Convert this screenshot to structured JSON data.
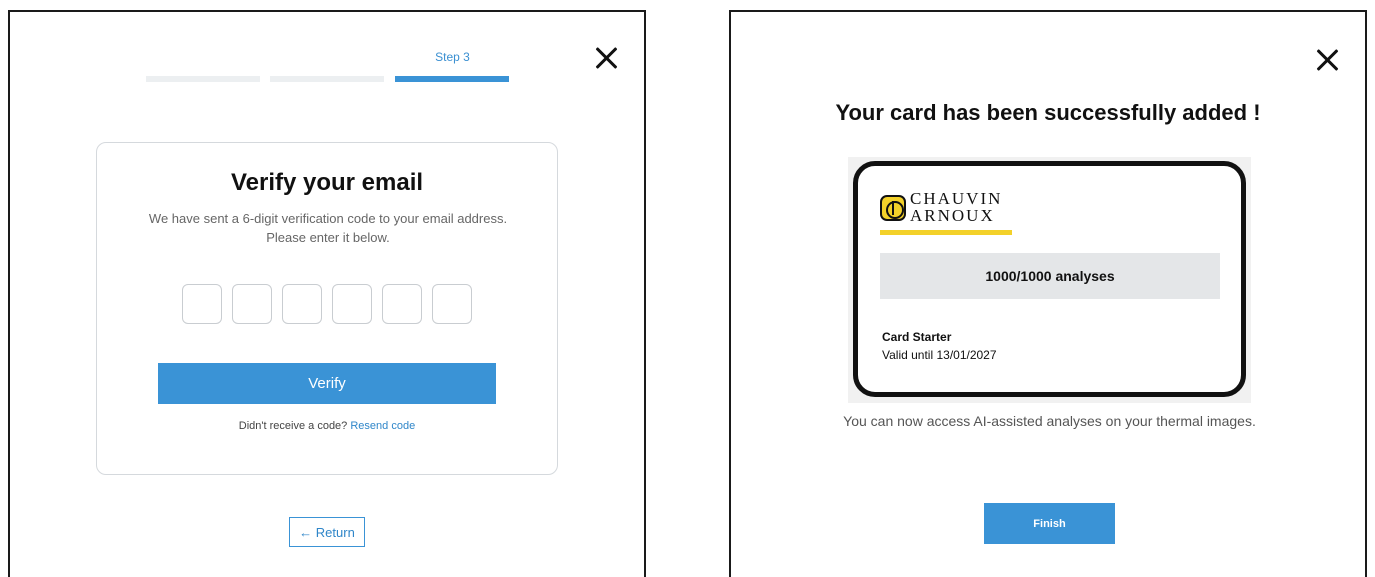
{
  "left_panel": {
    "step_label": "Step 3",
    "steps": [
      {
        "name": "step-1",
        "active": false
      },
      {
        "name": "step-2",
        "active": false
      },
      {
        "name": "step-3",
        "active": true
      }
    ],
    "title": "Verify your email",
    "description": "We have sent a 6-digit verification code to your email address. Please enter it below.",
    "code_digits": [
      "",
      "",
      "",
      "",
      "",
      ""
    ],
    "verify_label": "Verify",
    "resend_prompt": "Didn't receive a code?",
    "resend_link": "Resend code",
    "return_label": "← Return"
  },
  "right_panel": {
    "title": "Your card has been successfully added !",
    "brand": {
      "line1": "CHAUVIN",
      "line2": "ARNOUX"
    },
    "analyses": "1000/1000 analyses",
    "card_name": "Card Starter",
    "card_valid": "Valid until 13/01/2027",
    "description": "You can now access AI-assisted analyses on your thermal images.",
    "finish_label": "Finish"
  },
  "icons": {
    "close": "close-icon",
    "brand_mark": "chauvin-arnoux-logo-icon"
  },
  "colors": {
    "accent": "#3a93d6",
    "link": "#2f86c9",
    "brand_yellow": "#f3d12a"
  }
}
